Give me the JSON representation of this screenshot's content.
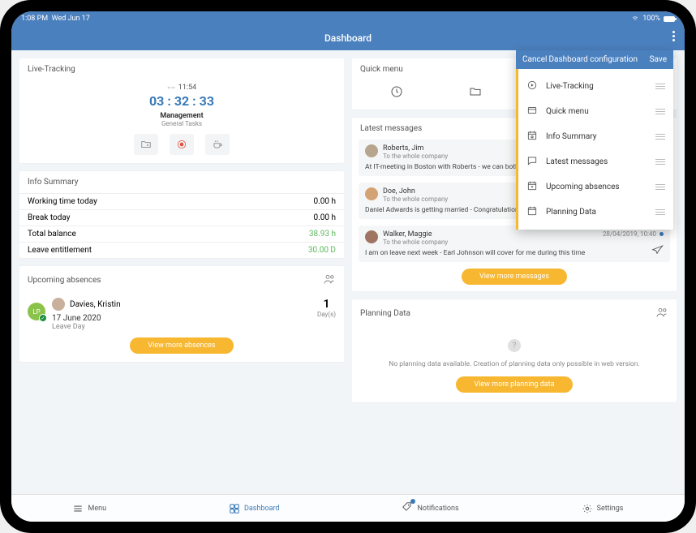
{
  "statusbar": {
    "time": "1:08 PM",
    "date": "Wed Jun 17",
    "battery": "100%"
  },
  "topbar": {
    "title": "Dashboard"
  },
  "config": {
    "cancel": "Cancel",
    "title": "Dashboard configuration",
    "save": "Save",
    "items": [
      "Live-Tracking",
      "Quick menu",
      "Info Summary",
      "Latest messages",
      "Upcoming absences",
      "Planning Data"
    ]
  },
  "live": {
    "header": "Live-Tracking",
    "clock_time": "11:54",
    "timer": "03 : 32 : 33",
    "task": "Management",
    "subtask": "General Tasks"
  },
  "quickmenu": {
    "header": "Quick menu"
  },
  "info": {
    "header": "Info Summary",
    "rows": [
      {
        "label": "Working time today",
        "value": "0.00 h",
        "green": false
      },
      {
        "label": "Break today",
        "value": "0.00 h",
        "green": false
      },
      {
        "label": "Total balance",
        "value": "38.93 h",
        "green": true
      },
      {
        "label": "Leave entitlement",
        "value": "30.00 D",
        "green": true
      }
    ]
  },
  "absences": {
    "header": "Upcoming absences",
    "badge": "LP",
    "name": "Davies, Kristin",
    "date": "17 June 2020",
    "type": "Leave Day",
    "count": "1",
    "count_label": "Day(s)",
    "more": "View more absences"
  },
  "messages": {
    "header": "Latest messages",
    "to_label": "To the whole company",
    "more": "View more messages",
    "items": [
      {
        "who": "Roberts, Jim",
        "text": "At IT-meeting in Boston with Roberts - we can both be"
      },
      {
        "who": "Doe, John",
        "text": "Daniel Adwards is getting married - Congratulations!"
      },
      {
        "who": "Walker, Maggie",
        "text": "I am on leave next week - Earl Johnson will cover for me during this time",
        "meta": "28/04/2019, 10:40"
      }
    ]
  },
  "planning": {
    "header": "Planning Data",
    "empty": "No planning data available. Creation of planning data only possible in web version.",
    "more": "View more planning data"
  },
  "nav": {
    "menu": "Menu",
    "dashboard": "Dashboard",
    "notifications": "Notifications",
    "settings": "Settings"
  }
}
